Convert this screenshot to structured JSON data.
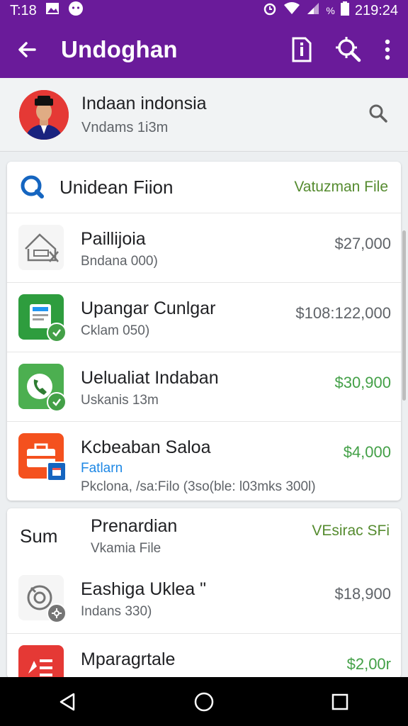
{
  "status_bar": {
    "time": "T:18",
    "right_text": "219:24"
  },
  "app_bar": {
    "title": "Undoghan",
    "icons": [
      "back-arrow-icon",
      "file-info-icon",
      "search-settings-icon",
      "more-vert-icon"
    ]
  },
  "account": {
    "name": "Indaan indonsia",
    "subtitle": "Vndams 1i3m"
  },
  "card1": {
    "header_title": "Unidean Fiion",
    "header_link": "Vatuzman File",
    "items": [
      {
        "title": "Paillijoia",
        "subtitle": "Bndana 000)",
        "amount": "$27,000",
        "amount_color": "gray",
        "icon": "house-sketch-icon"
      },
      {
        "title": "Upangar Cunlgar",
        "subtitle": "Cklam 050)",
        "amount": "$108:122,000",
        "amount_color": "gray",
        "icon": "document-green-icon"
      },
      {
        "title": "Uelualiat Indaban",
        "subtitle": "Uskanis 13m",
        "amount": "$30,900",
        "amount_color": "green",
        "icon": "phone-green-icon"
      },
      {
        "title": "Kcbeaban Saloa",
        "subtitle": "Fatlarn",
        "detail": "Pkclona, /sa:Filo (3so(ble: l03mks 300l)",
        "amount": "$4,000",
        "amount_color": "green",
        "icon": "briefcase-orange-icon"
      }
    ]
  },
  "card2": {
    "label": "Sum",
    "header_title": "Prenardian",
    "header_subtitle": "Vkamia File",
    "header_link": "VEsirac SFi",
    "items": [
      {
        "title": "Eashiga Uklea \"",
        "subtitle": "Indans 330)",
        "amount": "$18,900",
        "amount_color": "gray",
        "icon": "camera-gear-icon"
      },
      {
        "title": "Mparagrtale",
        "subtitle": "",
        "amount": "$2,00r",
        "amount_color": "green",
        "icon": "document-red-icon"
      }
    ]
  },
  "colors": {
    "primary": "#6a1b9a",
    "green": "#43a047",
    "link_green": "#558b2f",
    "blue": "#1e88e5"
  }
}
